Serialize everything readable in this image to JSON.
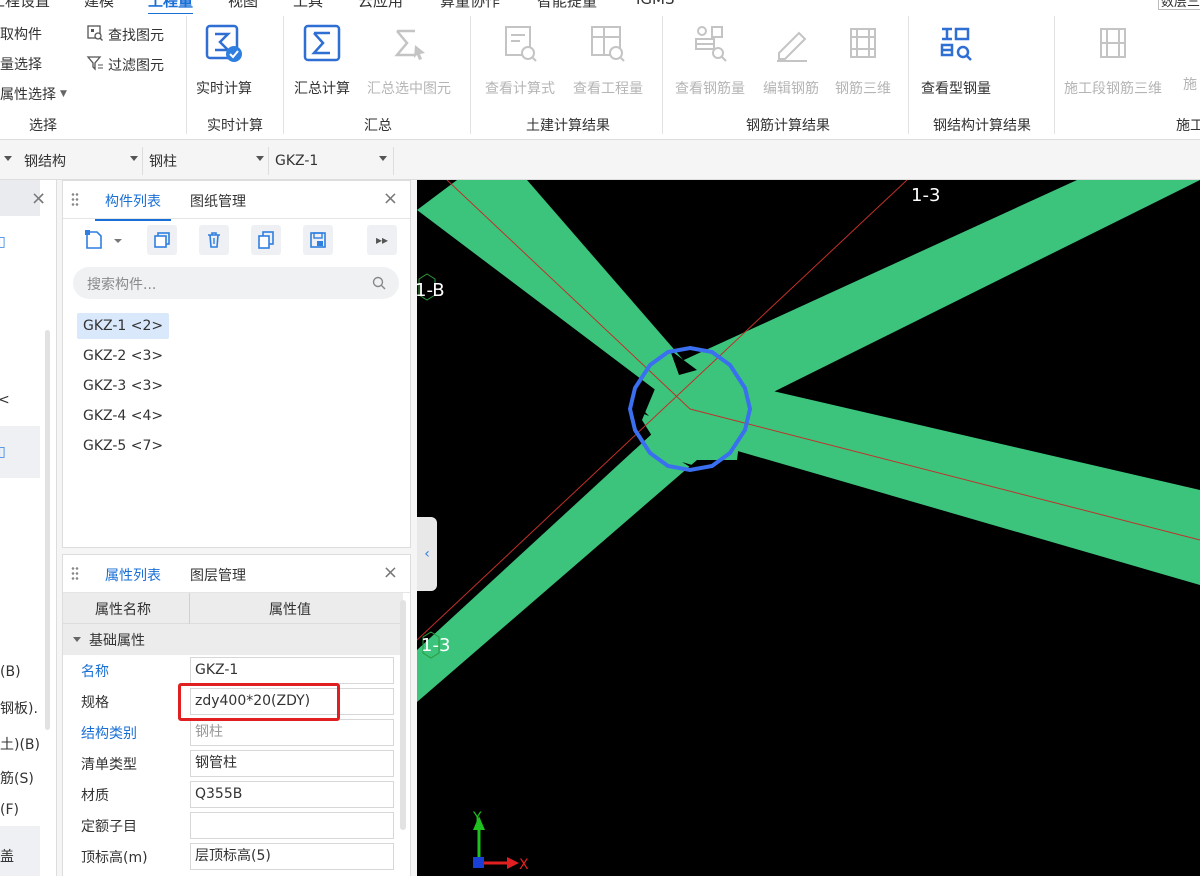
{
  "menu": {
    "tabs": [
      "工程设置",
      "建模",
      "工程量",
      "视图",
      "工具",
      "云应用",
      "算量协作",
      "智能提量",
      "IGMS"
    ],
    "active_tab": "工程量",
    "right_field": "数层三"
  },
  "ribbon": {
    "select_group": {
      "items": [
        "拾取构件",
        "批量选择",
        "按属性选择"
      ],
      "items_visible": [
        "取构件",
        "量选择",
        "属性选择"
      ],
      "find": "查找图元",
      "filter": "过滤图元",
      "label": "选择"
    },
    "realtime": {
      "button": "实时计算",
      "label": "实时计算"
    },
    "summary": {
      "sum_all": "汇总计算",
      "sum_selected": "汇总选中图元",
      "label": "汇总"
    },
    "civil": {
      "view_formula": "查看计算式",
      "view_quantity": "查看工程量",
      "label": "土建计算结果"
    },
    "rebar": {
      "view_rebar": "查看钢筋量",
      "edit_rebar": "编辑钢筋",
      "rebar_3d": "钢筋三维",
      "label": "钢筋计算结果"
    },
    "steel": {
      "view_steel": "查看型钢量",
      "label": "钢结构计算结果"
    },
    "construction": {
      "segment_rebar_3d": "施工段钢筋三维",
      "more": "施",
      "label": "施工"
    }
  },
  "selectors": {
    "category": "钢结构",
    "type": "钢柱",
    "component": "GKZ-1"
  },
  "left_panel": {
    "items": [
      "(B)",
      "钢板).",
      "土)(B)",
      "筋(S)",
      "(F)",
      "盖"
    ]
  },
  "component_panel": {
    "tabs": [
      "构件列表",
      "图纸管理"
    ],
    "search_placeholder": "搜索构件...",
    "items": [
      "GKZ-1 <2>",
      "GKZ-2 <3>",
      "GKZ-3 <3>",
      "GKZ-4 <4>",
      "GKZ-5 <7>"
    ],
    "selected": "GKZ-1 <2>"
  },
  "property_panel": {
    "tabs": [
      "属性列表",
      "图层管理"
    ],
    "col_name": "属性名称",
    "col_value": "属性值",
    "group": "基础属性",
    "rows": [
      {
        "name": "名称",
        "value": "GKZ-1"
      },
      {
        "name": "规格",
        "value": "zdy400*20(ZDY)"
      },
      {
        "name": "结构类别",
        "value": "钢柱"
      },
      {
        "name": "清单类型",
        "value": "钢管柱"
      },
      {
        "name": "材质",
        "value": "Q355B"
      },
      {
        "name": "定额子目",
        "value": ""
      },
      {
        "name": "顶标高(m)",
        "value": "层顶标高(5)"
      }
    ]
  },
  "viewport": {
    "axis_labels": [
      "1-3",
      "1-B",
      "1-3"
    ],
    "axis_y": "Y",
    "axis_x": "X",
    "colors": {
      "beam": "#3cc47c",
      "column_ring": "#3a6ff0",
      "axis_line": "#c0302a",
      "background": "#000000"
    }
  }
}
